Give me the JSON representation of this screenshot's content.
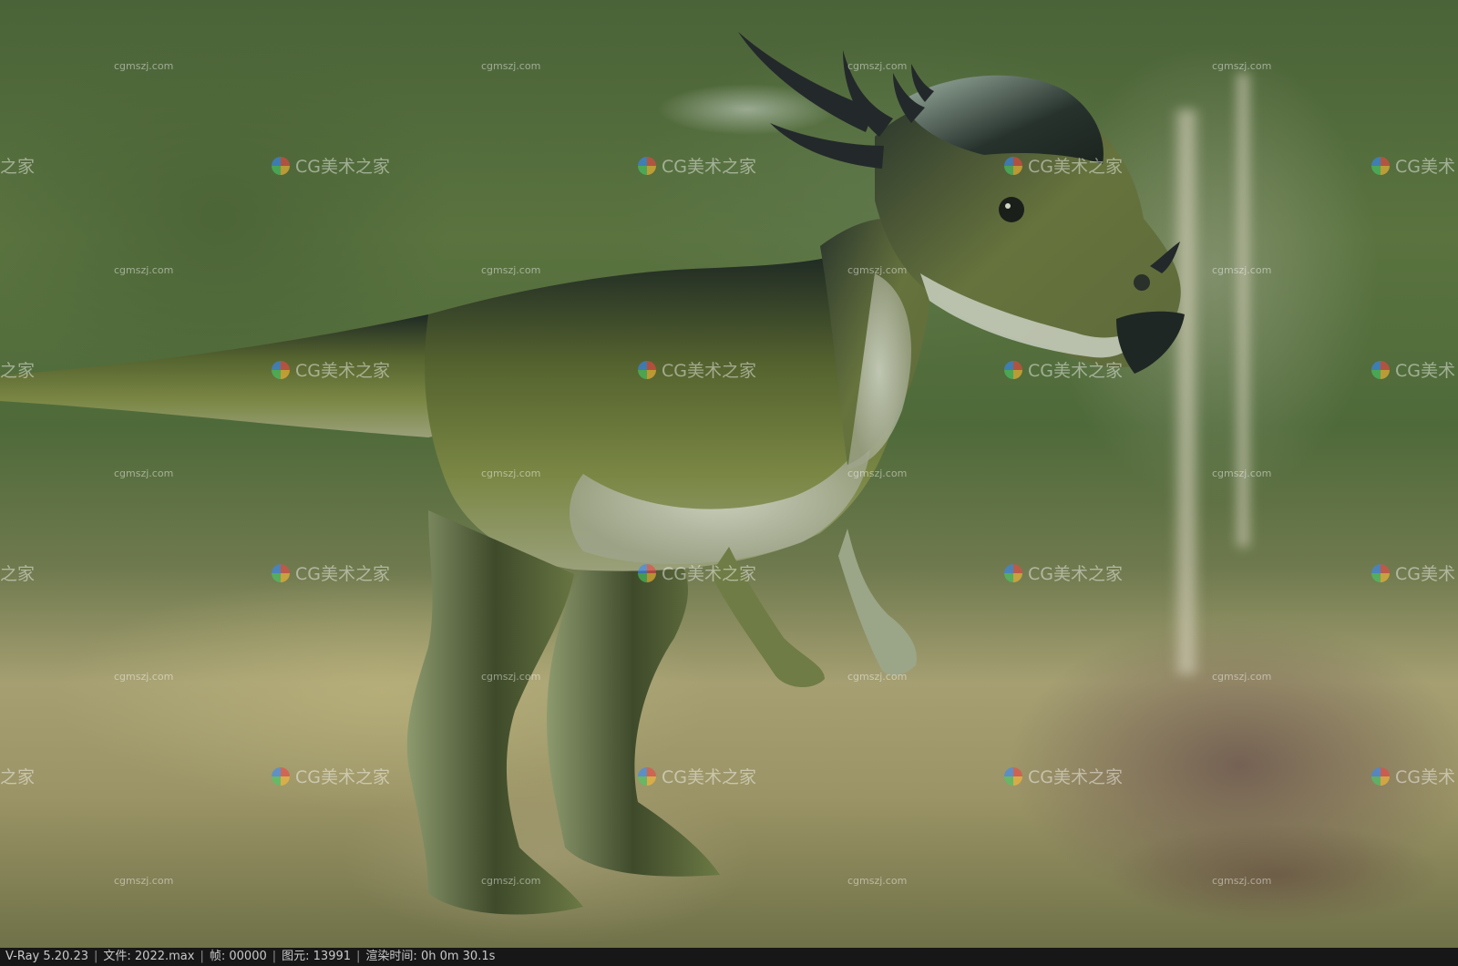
{
  "status_bar": {
    "renderer": "V-Ray 5.20.23",
    "file_label": "文件:",
    "file_value": "2022.max",
    "frame_label": "帧:",
    "frame_value": "00000",
    "primitives_label": "图元:",
    "primitives_value": "13991",
    "render_time_label": "渲染时间:",
    "render_time_value": "0h  0m 30.1s"
  },
  "watermarks": {
    "small_text": "cgmszj.com",
    "logo_text": "CG美术之家",
    "logo_text_clipped_left": "之家",
    "logo_text_clipped_right": "CG美术"
  },
  "colors": {
    "status_bar_bg": "#171717",
    "status_bar_text": "#c9c9c9",
    "dino_dark": "#1f2a24",
    "dino_green": "#6b7a3c",
    "dino_belly": "#c9cfc0"
  },
  "image": {
    "subject": "dinosaur-render"
  }
}
